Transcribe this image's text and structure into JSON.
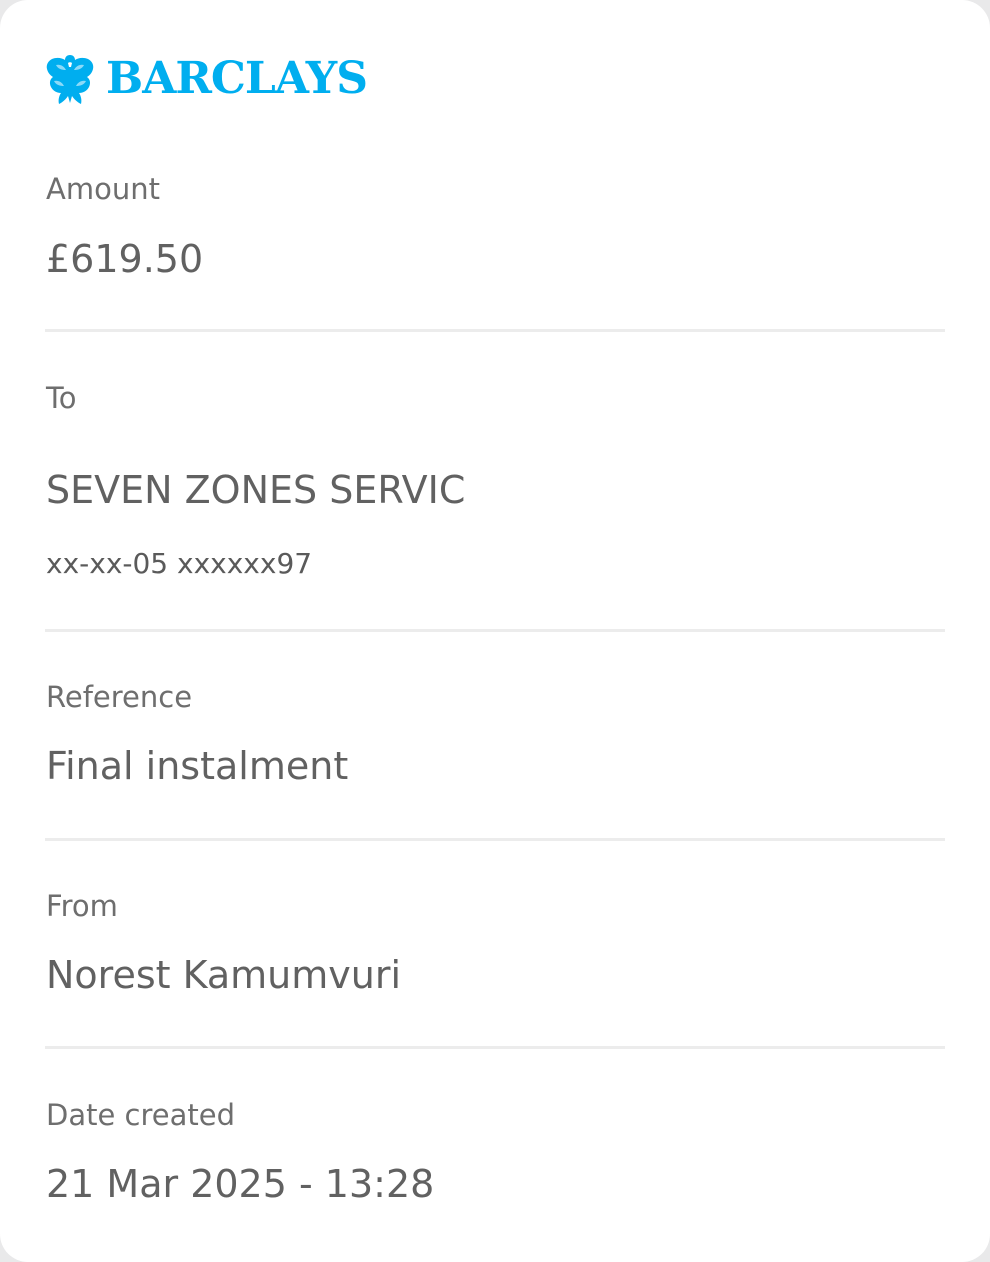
{
  "brand": {
    "name": "BARCLAYS",
    "color": "#00aeef",
    "icon": "eagle-icon"
  },
  "fields": {
    "amount": {
      "label": "Amount",
      "value": "£619.50"
    },
    "to": {
      "label": "To",
      "value": "SEVEN ZONES SERVIC",
      "account": "xx-xx-05 xxxxxx97"
    },
    "reference": {
      "label": "Reference",
      "value": "Final instalment"
    },
    "from": {
      "label": "From",
      "value": "Norest Kamumvuri"
    },
    "date_created": {
      "label": "Date created",
      "value": "21 Mar 2025 - 13:28"
    }
  }
}
